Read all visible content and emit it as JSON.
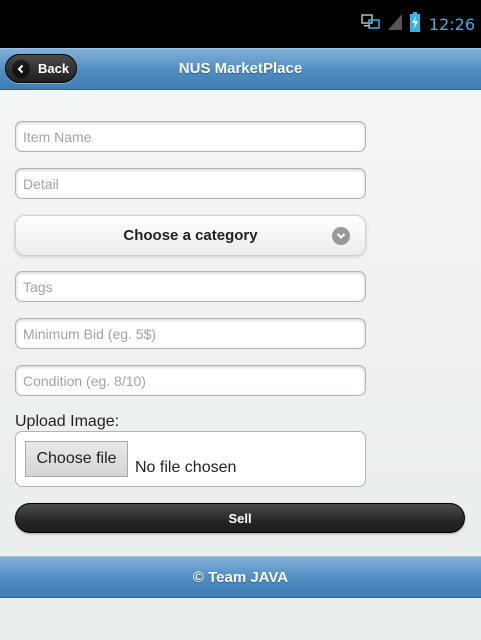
{
  "status_bar": {
    "time": "12:26",
    "icons": [
      "network-sync-icon",
      "signal-icon",
      "battery-charging-icon"
    ],
    "time_color": "#33b5e5"
  },
  "header": {
    "back_label": "Back",
    "title": "NUS MarketPlace"
  },
  "form": {
    "item_name_placeholder": "Item Name",
    "detail_placeholder": "Detail",
    "category_label": "Choose a category",
    "tags_placeholder": "Tags",
    "min_bid_placeholder": "Minimum Bid (eg. 5$)",
    "condition_placeholder": "Condition (eg. 8/10)",
    "upload_label": "Upload Image:",
    "choose_file_label": "Choose file",
    "file_status": "No file chosen",
    "sell_label": "Sell"
  },
  "footer": {
    "text": "© Team JAVA"
  },
  "colors": {
    "header_blue": "#4f8cc1",
    "button_dark": "#262626",
    "status_accent": "#33b5e5"
  }
}
